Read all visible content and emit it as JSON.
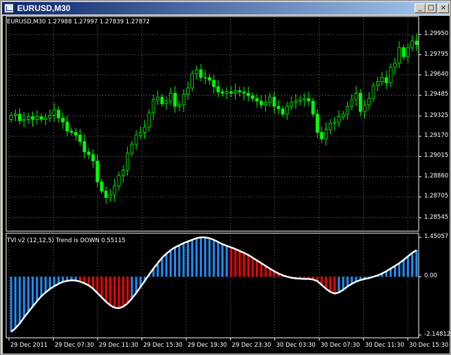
{
  "window": {
    "title": "EURUSD,M30",
    "buttons": {
      "minimize": "_",
      "maximize": "□",
      "close": "×"
    }
  },
  "price_panel": {
    "header": "EURUSD,M30  1.27988 1.27997 1.27839 1.27872",
    "y_ticks": [
      "1.29950",
      "1.29795",
      "1.29640",
      "1.29485",
      "1.29325",
      "1.29170",
      "1.29015",
      "1.28860",
      "1.28705",
      "1.28545"
    ]
  },
  "indicator_panel": {
    "header": "TVI v2 (12,12,5) Trend is DOWN 0.55115",
    "y_ticks": [
      "1.45057",
      "0.00",
      "-2.14812"
    ]
  },
  "x_ticks": [
    "29 Dec 2011",
    "29 Dec 07:30",
    "29 Dec 11:30",
    "29 Dec 15:30",
    "29 Dec 19:30",
    "29 Dec 23:30",
    "30 Dec 03:30",
    "30 Dec 07:30",
    "30 Dec 11:30",
    "30 Dec 15:30"
  ],
  "colors": {
    "bull": "#00ff00",
    "bear": "#000000",
    "up_hist": "#1e90ff",
    "down_hist": "#ff0000",
    "signal": "#ffffff",
    "grid": "#c0c0c0"
  },
  "chart_data": [
    {
      "type": "candlestick",
      "title": "EURUSD,M30",
      "ylim": [
        1.2849,
        1.3003
      ],
      "x": [
        "29 Dec 2011",
        "29 Dec 07:30",
        "29 Dec 11:30",
        "29 Dec 15:30",
        "29 Dec 19:30",
        "29 Dec 23:30",
        "30 Dec 03:30",
        "30 Dec 07:30",
        "30 Dec 11:30",
        "30 Dec 15:30"
      ],
      "closes": [
        1.2933,
        1.2934,
        1.2929,
        1.293,
        1.2932,
        1.293,
        1.2932,
        1.293,
        1.2931,
        1.2933,
        1.2937,
        1.2931,
        1.2928,
        1.2921,
        1.292,
        1.2918,
        1.2913,
        1.2905,
        1.2903,
        1.2898,
        1.2882,
        1.2875,
        1.287,
        1.2872,
        1.2879,
        1.2887,
        1.2891,
        1.2904,
        1.2911,
        1.2918,
        1.292,
        1.2924,
        1.2935,
        1.2945,
        1.2947,
        1.2942,
        1.2944,
        1.295,
        1.294,
        1.2941,
        1.2949,
        1.2954,
        1.2965,
        1.2968,
        1.2962,
        1.2962,
        1.296,
        1.2955,
        1.2951,
        1.295,
        1.2951,
        1.295,
        1.2952,
        1.2951,
        1.295,
        1.2948,
        1.2946,
        1.2944,
        1.2941,
        1.2943,
        1.2947,
        1.294,
        1.2938,
        1.2934,
        1.294,
        1.2943,
        1.2944,
        1.2945,
        1.2946,
        1.2944,
        1.2934,
        1.292,
        1.2915,
        1.2922,
        1.2927,
        1.2928,
        1.2932,
        1.2934,
        1.294,
        1.2945,
        1.295,
        1.2936,
        1.2941,
        1.2946,
        1.2956,
        1.2959,
        1.2962,
        1.2958,
        1.297,
        1.2973,
        1.2985,
        1.2978,
        1.2985,
        1.299,
        1.29872
      ]
    },
    {
      "type": "bar",
      "title": "TVI v2 (12,12,5)",
      "ylim": [
        -2.14812,
        1.45057
      ],
      "values": [
        -2.03,
        -1.9,
        -1.72,
        -1.5,
        -1.3,
        -1.1,
        -0.9,
        -0.72,
        -0.58,
        -0.45,
        -0.35,
        -0.26,
        -0.19,
        -0.15,
        -0.13,
        -0.14,
        -0.18,
        -0.24,
        -0.32,
        -0.44,
        -0.6,
        -0.76,
        -0.92,
        -1.05,
        -1.14,
        -1.16,
        -1.1,
        -0.98,
        -0.8,
        -0.6,
        -0.38,
        -0.15,
        0.08,
        0.3,
        0.5,
        0.7,
        0.85,
        0.98,
        1.08,
        1.16,
        1.24,
        1.3,
        1.36,
        1.42,
        1.45,
        1.45,
        1.42,
        1.36,
        1.28,
        1.2,
        1.14,
        1.08,
        1.02,
        0.95,
        0.88,
        0.8,
        0.7,
        0.6,
        0.5,
        0.4,
        0.3,
        0.2,
        0.12,
        0.05,
        0.0,
        -0.04,
        -0.06,
        -0.07,
        -0.08,
        -0.08,
        -0.1,
        -0.16,
        -0.3,
        -0.44,
        -0.56,
        -0.62,
        -0.58,
        -0.48,
        -0.36,
        -0.26,
        -0.18,
        -0.12,
        -0.08,
        -0.05,
        0.0,
        0.05,
        0.12,
        0.2,
        0.3,
        0.4,
        0.5,
        0.62,
        0.75,
        0.88,
        0.98
      ],
      "signal": [
        -2.03,
        -1.9,
        -1.72,
        -1.5,
        -1.3,
        -1.1,
        -0.9,
        -0.72,
        -0.58,
        -0.45,
        -0.35,
        -0.26,
        -0.19,
        -0.15,
        -0.13,
        -0.14,
        -0.18,
        -0.24,
        -0.32,
        -0.44,
        -0.6,
        -0.76,
        -0.92,
        -1.05,
        -1.14,
        -1.16,
        -1.1,
        -0.98,
        -0.8,
        -0.6,
        -0.38,
        -0.15,
        0.08,
        0.3,
        0.5,
        0.7,
        0.85,
        0.98,
        1.08,
        1.16,
        1.24,
        1.3,
        1.36,
        1.42,
        1.45,
        1.45,
        1.42,
        1.36,
        1.28,
        1.2,
        1.14,
        1.08,
        1.02,
        0.95,
        0.88,
        0.8,
        0.7,
        0.6,
        0.5,
        0.4,
        0.3,
        0.2,
        0.12,
        0.05,
        0.0,
        -0.04,
        -0.06,
        -0.07,
        -0.08,
        -0.08,
        -0.1,
        -0.16,
        -0.3,
        -0.44,
        -0.56,
        -0.62,
        -0.58,
        -0.48,
        -0.36,
        -0.26,
        -0.18,
        -0.12,
        -0.08,
        -0.05,
        0.0,
        0.05,
        0.12,
        0.2,
        0.3,
        0.4,
        0.5,
        0.62,
        0.75,
        0.88,
        0.98
      ],
      "red_ranges": [
        [
          16,
          27
        ],
        [
          51,
          63
        ],
        [
          66,
          75
        ]
      ]
    }
  ]
}
